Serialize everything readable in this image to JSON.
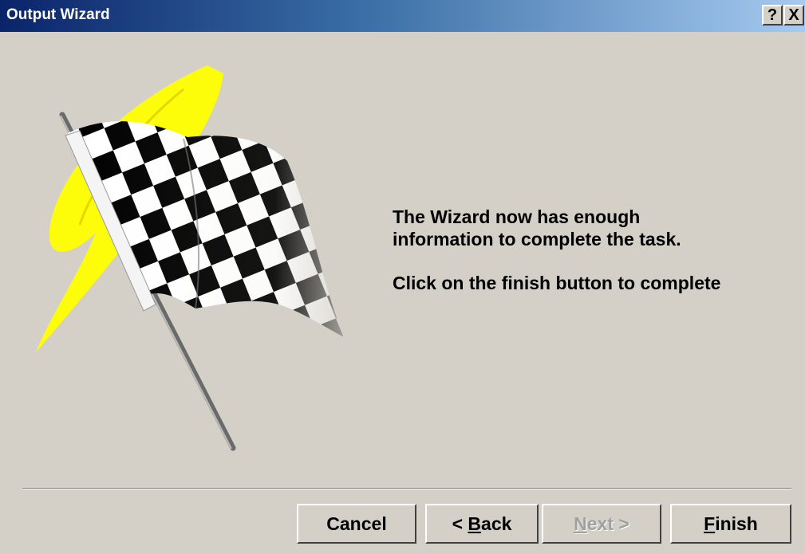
{
  "window": {
    "title": "Output Wizard",
    "help_label": "?",
    "close_label": "X"
  },
  "message": {
    "line1": "The Wizard now has enough",
    "line2": "information to complete the task.",
    "line3": "Click on the finish button to complete"
  },
  "buttons": {
    "cancel": "Cancel",
    "back_prefix": "< ",
    "back_mnemonic": "B",
    "back_rest": "ack",
    "next_mnemonic": "N",
    "next_rest": "ext >",
    "finish_mnemonic": "F",
    "finish_rest": "inish"
  },
  "colors": {
    "titlebar_start": "#0a246a",
    "titlebar_end": "#a6caf0",
    "face": "#d4d0c8",
    "flag_accent": "#ffff00"
  },
  "icons": {
    "illustration": "checkered-flag-icon"
  }
}
